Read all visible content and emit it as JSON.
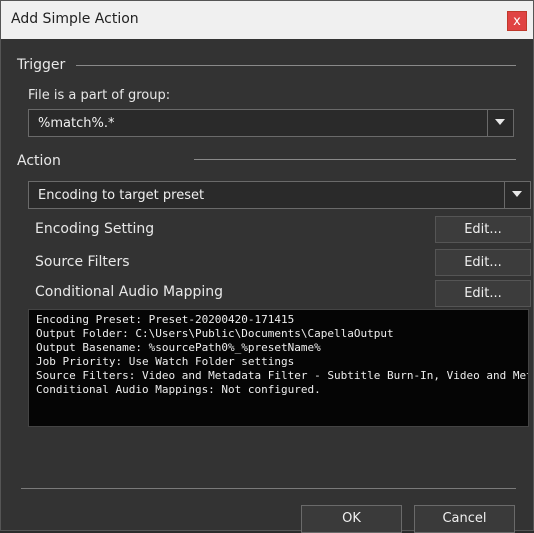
{
  "window": {
    "title": "Add Simple Action",
    "close_label": "x"
  },
  "trigger": {
    "section_label": "Trigger",
    "group_label": "File is a part of group:",
    "group_value": "%match%.*"
  },
  "action": {
    "section_label": "Action",
    "selected": "Encoding to target preset",
    "rows": [
      {
        "label": "Encoding Setting",
        "button": "Edit..."
      },
      {
        "label": "Source Filters",
        "button": "Edit..."
      },
      {
        "label": "Conditional Audio Mapping",
        "button": "Edit..."
      }
    ]
  },
  "summary_lines": [
    "Encoding Preset: Preset-20200420-171415",
    "Output Folder: C:\\Users\\Public\\Documents\\CapellaOutput",
    "Output Basename: %sourcePath0%_%presetName%",
    "Job Priority: Use Watch Folder settings",
    "Source Filters: Video and Metadata Filter - Subtitle Burn-In, Video and Metadata Filter",
    "Conditional Audio Mappings: Not configured."
  ],
  "buttons": {
    "ok": "OK",
    "cancel": "Cancel"
  }
}
